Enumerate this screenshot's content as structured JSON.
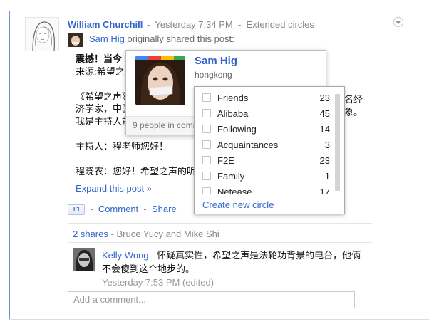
{
  "post": {
    "author": "William Churchill",
    "separator": "-",
    "timestamp": "Yesterday 7:34 PM",
    "visibility": "Extended circles",
    "shared_by": "Sam Hig",
    "shared_text": "originally shared this post:",
    "lines": [
      {
        "text": "震撼！当今",
        "bold": true
      },
      {
        "text": "来源:希望之",
        "bold": false
      },
      {
        "text": "",
        "bold": false
      },
      {
        "text": "《希望之声》",
        "bold": false
      },
      {
        "text": "济学家，中国",
        "bold": false
      },
      {
        "text": "我是主持人前",
        "bold": false
      },
      {
        "text": "",
        "bold": false
      },
      {
        "text": "主持人：程老师您好！",
        "bold": false
      },
      {
        "text": "",
        "bold": false
      },
      {
        "text": "程晓农：您好！希望之声的听",
        "bold": false
      }
    ],
    "right_fragments": [
      "著名经",
      "万象。"
    ],
    "expand_label": "Expand this post »"
  },
  "actions": {
    "plus_one": "+1",
    "comment": "Comment",
    "share": "Share",
    "separator": "-"
  },
  "shares": {
    "count_label": "2 shares",
    "separator": "-",
    "names": "Bruce Yucy and Mike Shi"
  },
  "comment": {
    "author": "Kelly Wong",
    "text": "- 怀疑真实性，希望之声是法轮功背景的电台，他俩不会傻到这个地步的。",
    "timestamp": "Yesterday 7:53 PM (edited)"
  },
  "add_comment": {
    "placeholder": "Add a comment..."
  },
  "hovercard": {
    "name": "Sam Hig",
    "location": "hongkong",
    "footer": "9 people in common"
  },
  "circles": {
    "items": [
      {
        "label": "Friends",
        "count": "23"
      },
      {
        "label": "Alibaba",
        "count": "45"
      },
      {
        "label": "Following",
        "count": "14"
      },
      {
        "label": "Acquaintances",
        "count": "3"
      },
      {
        "label": "F2E",
        "count": "23"
      },
      {
        "label": "Family",
        "count": "1"
      },
      {
        "label": "Netease",
        "count": "17"
      }
    ],
    "create_label": "Create new circle"
  },
  "colors": {
    "link": "#3366cc",
    "muted": "#888888"
  }
}
